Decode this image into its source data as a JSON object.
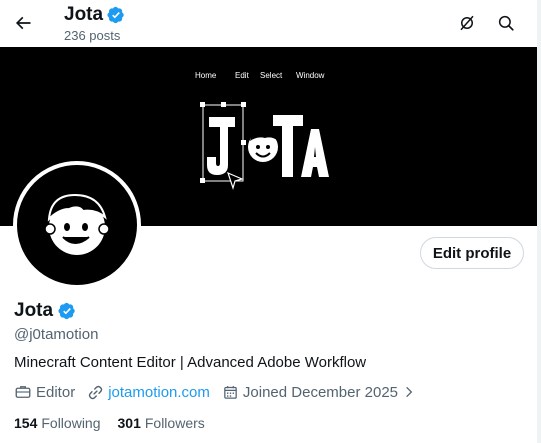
{
  "header": {
    "name": "Jota",
    "posts": "236 posts"
  },
  "banner": {
    "menu": [
      "Home",
      "Edit",
      "Select",
      "Window"
    ],
    "logo_text": "JOTA"
  },
  "profile": {
    "name": "Jota",
    "handle": "@j0tamotion",
    "bio": "Minecraft Content Editor | Advanced Adobe Workflow",
    "edit_button": "Edit profile",
    "category": "Editor",
    "website": "jotamotion.com",
    "joined": "Joined December 2025",
    "following_count": "154",
    "following_label": "Following",
    "followers_count": "301",
    "followers_label": "Followers"
  },
  "colors": {
    "verified": "#1d9bf0",
    "link": "#1d9bf0",
    "muted": "#536471"
  }
}
